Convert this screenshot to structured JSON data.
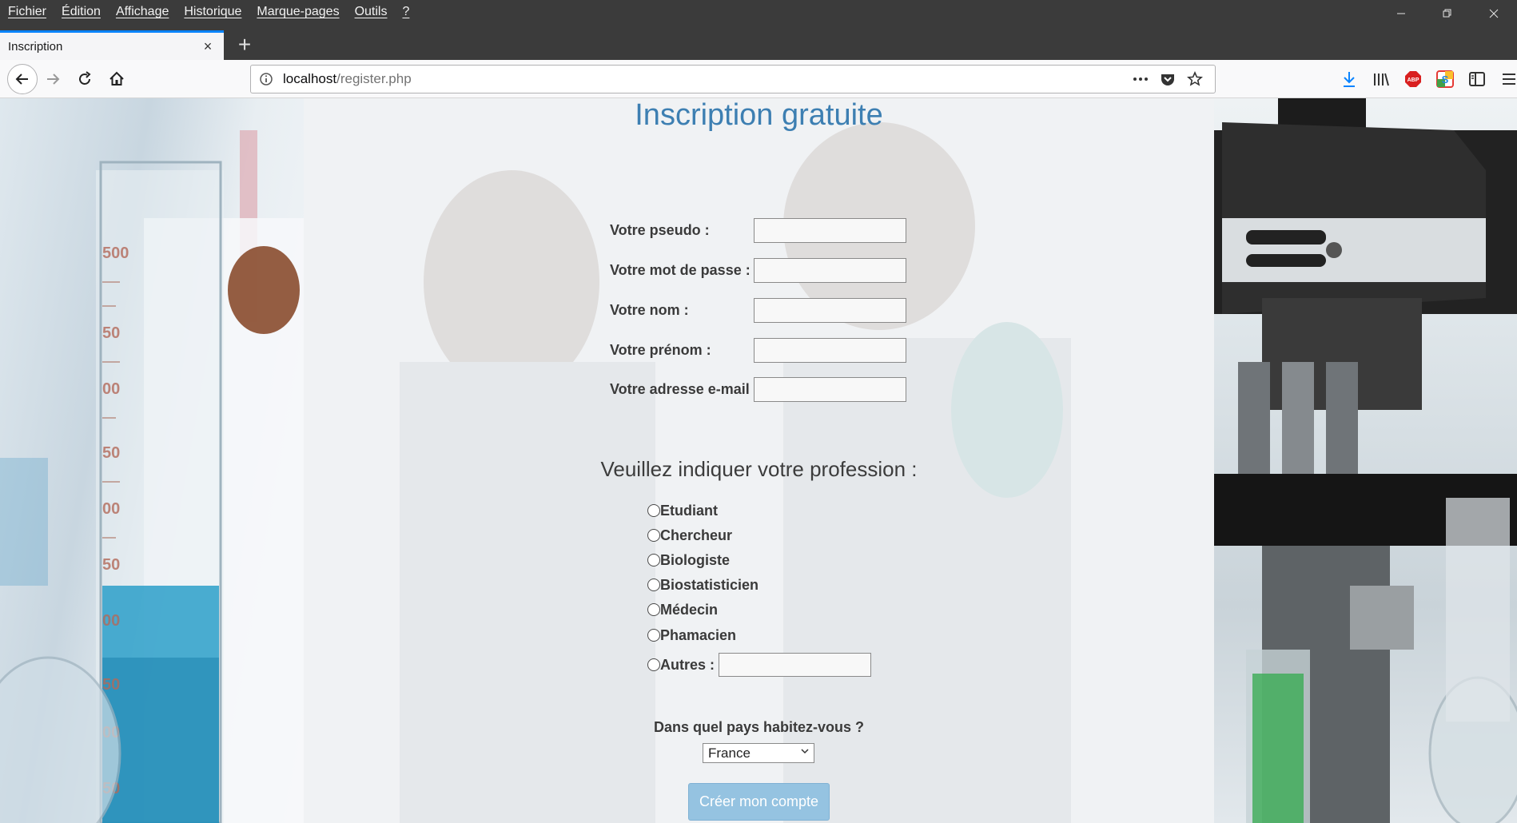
{
  "menubar": {
    "items": [
      "Fichier",
      "Édition",
      "Affichage",
      "Historique",
      "Marque-pages",
      "Outils",
      "?"
    ]
  },
  "tab": {
    "title": "Inscription",
    "close": "×"
  },
  "newtab": "+",
  "urlbar": {
    "host": "localhost",
    "path": "/register.php"
  },
  "page": {
    "title": "Inscription gratuite",
    "fields": [
      {
        "label": "Votre pseudo :",
        "value": ""
      },
      {
        "label": "Votre mot de passe :",
        "value": ""
      },
      {
        "label": "Votre nom :",
        "value": ""
      },
      {
        "label": "Votre prénom :",
        "value": ""
      },
      {
        "label": "Votre adresse e-mail :",
        "value": ""
      }
    ],
    "profession_title": "Veuillez indiquer votre profession :",
    "professions": [
      "Etudiant",
      "Chercheur",
      "Biologiste",
      "Biostatisticien",
      "Médecin",
      "Phamacien",
      "Autres :"
    ],
    "country_label": "Dans quel pays habitez-vous ?",
    "country_selected": "France",
    "submit_label": "Créer mon compte"
  },
  "colors": {
    "title": "#3d7fb2",
    "button": "#95c3e1",
    "tab_accent": "#0a84ff",
    "chrome_dark": "#3b3b3b"
  },
  "icons": [
    "back-arrow-icon",
    "forward-arrow-icon",
    "reload-icon",
    "home-icon",
    "info-icon",
    "more-icon",
    "pocket-icon",
    "star-icon",
    "download-icon",
    "library-icon",
    "adblock-icon",
    "extension-icon",
    "sidebar-icon",
    "menu-icon"
  ]
}
